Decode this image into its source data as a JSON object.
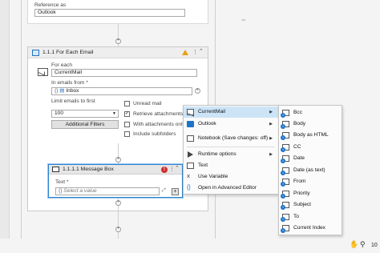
{
  "top": {
    "reference_label": "Reference as",
    "reference_value": "Outlook"
  },
  "foreach": {
    "title": "1.1.1 For Each Email",
    "for_each_label": "For each",
    "for_each_value": "CurrentMail",
    "in_emails_label": "In emails from *",
    "folder_value": "Inbox",
    "limit_label": "Limit emails to first",
    "limit_value": "100",
    "additional_filters": "Additional Filters",
    "unread_mail": "Unread mail",
    "retrieve_attachments": "Retrieve attachments",
    "with_attachments_only": "With attachments only",
    "include_subfolders": "Include subfolders"
  },
  "msgbox": {
    "title": "1.1.1.1 Message Box",
    "text_label": "Text *",
    "placeholder": "Select a value"
  },
  "menu": {
    "items": [
      {
        "label": "CurrentMail",
        "icon": "envelope-icon",
        "arrow": "▶"
      },
      {
        "label": "Outlook",
        "icon": "outlook-icon",
        "arrow": "▶"
      },
      {
        "label": "Notebook (Save changes: off)",
        "icon": "notebook-icon",
        "arrow": "▶"
      },
      {
        "label": "Runtime options",
        "icon": "play-icon",
        "arrow": "▶"
      },
      {
        "label": "Text",
        "icon": "text-icon"
      },
      {
        "label": "Use Variable",
        "icon": "variable-icon"
      },
      {
        "label": "Open in Advanced Editor",
        "icon": "braces-icon"
      }
    ]
  },
  "submenu": {
    "items": [
      "Bcc",
      "Body",
      "Body as HTML",
      "CC",
      "Date",
      "Date (as text)",
      "From",
      "Priority",
      "Subject",
      "To",
      "Current Index"
    ]
  },
  "status": {
    "zoom": "10"
  }
}
